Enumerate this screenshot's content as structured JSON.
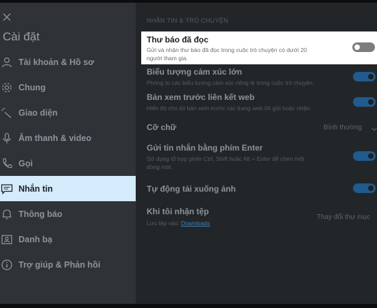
{
  "sidebar": {
    "title": "Cài đặt",
    "items": [
      {
        "label": "Tài khoản & Hồ sơ",
        "icon": "person-icon"
      },
      {
        "label": "Chung",
        "icon": "gear-icon"
      },
      {
        "label": "Giao diện",
        "icon": "wand-icon"
      },
      {
        "label": "Âm thanh & video",
        "icon": "microphone-icon"
      },
      {
        "label": "Gọi",
        "icon": "phone-icon"
      },
      {
        "label": "Nhắn tin",
        "icon": "chat-icon",
        "active": true
      },
      {
        "label": "Thông báo",
        "icon": "bell-icon"
      },
      {
        "label": "Danh bạ",
        "icon": "contact-card-icon"
      },
      {
        "label": "Trợ giúp & Phản hồi",
        "icon": "info-icon"
      }
    ]
  },
  "main": {
    "section_title": "NHẮN TIN & TRÒ CHUYỆN",
    "read_receipts": {
      "title": "Thư báo đã đọc",
      "desc_line1": "Gửi và nhận thư báo đã đọc trong cuộc trò chuyện có dưới 20",
      "desc_line2": "người tham gia.",
      "enabled": false
    },
    "large_emoticons": {
      "title": "Biểu tượng cảm xúc lớn",
      "desc": "Phóng to các biểu tượng cảm xúc riêng lẻ trong cuộc trò chuyện.",
      "enabled": true
    },
    "web_link_preview": {
      "title": "Bản xem trước liên kết web",
      "desc": "Hiển thị cho tôi bản xem trước các trang web tôi gửi hoặc nhận.",
      "enabled": true
    },
    "font_size": {
      "title": "Cỡ chữ",
      "value": "Bình thường"
    },
    "enter_to_send": {
      "title": "Gửi tin nhắn bằng phím Enter",
      "desc_line1": "Sử dụng tổ hợp phím Ctrl, Shift hoặc Alt + Enter để chèn một",
      "desc_line2": "dòng mới.",
      "enabled": true
    },
    "auto_download": {
      "title": "Tự động tải xuống ảnh",
      "enabled": true
    },
    "receive_files": {
      "title": "Khi tôi nhận tệp",
      "desc_prefix": "Lưu tệp vào:",
      "desc_link": "Downloads",
      "action": "Thay đổi thư mục"
    }
  },
  "colors": {
    "sidebar_bg": "#2f3236",
    "main_bg": "#232629",
    "active_item_bg": "#d3ebfa",
    "toggle_on": "#1f5b8e",
    "toggle_off": "#7d7d7d",
    "highlight_card": "#ffffff"
  }
}
